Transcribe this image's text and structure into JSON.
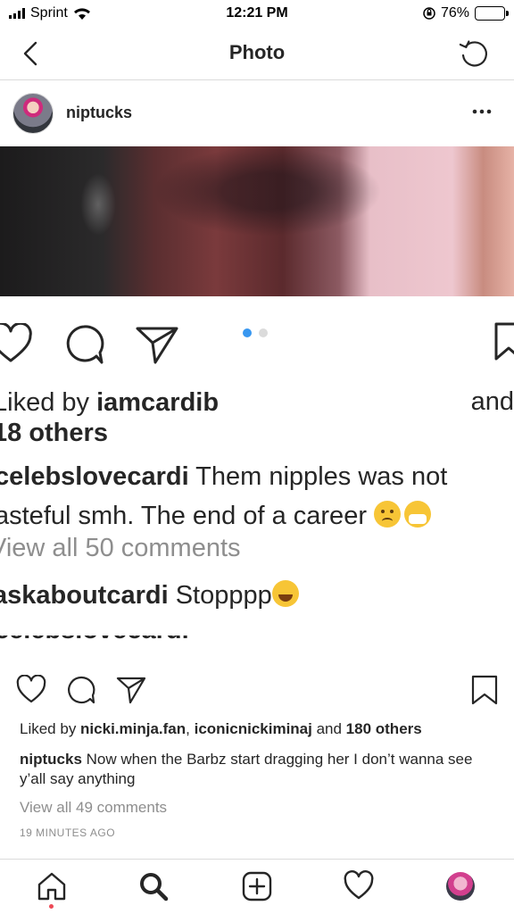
{
  "status_bar": {
    "carrier": "Sprint",
    "time": "12:21 PM",
    "battery": "76%",
    "battery_level": 0.76
  },
  "nav": {
    "title": "Photo"
  },
  "post": {
    "username": "niptucks",
    "photo": {
      "liked_prefix": "Liked by ",
      "liked_user": "iamcardib",
      "liked_and": "and",
      "liked_others": "18 others",
      "caption_user": "celebslovecardi",
      "caption_line1": " Them nipples was not",
      "caption_line2": "asteful smh. The end of a career ",
      "view_all": "View all 50 comments",
      "comment_user": "askaboutcardi",
      "comment_text": " Stopppp",
      "carousel_pages": 2,
      "carousel_active": 1
    },
    "likes_prefix": "Liked by ",
    "liked_by_1": "nicki.minja.fan",
    "likes_sep": ", ",
    "liked_by_2": "iconicnickiminaj",
    "likes_and": " and ",
    "likes_others": "180 others",
    "caption_user": "niptucks",
    "caption_text": " Now when the Barbz start dragging her I don’t wanna see y’all say anything",
    "view_comments": "View all 49 comments",
    "time_ago": "19 MINUTES AGO"
  },
  "icons": {
    "back": "chevron-left-icon",
    "refresh": "refresh-icon",
    "more": "more-icon",
    "like": "heart-icon",
    "comment": "comment-icon",
    "share": "send-icon",
    "save": "bookmark-icon",
    "home": "home-icon",
    "search": "search-icon",
    "new_post": "add-icon",
    "activity": "heart-icon"
  },
  "colors": {
    "link_blue": "#3897f0",
    "muted": "#8e8e8e",
    "text": "#262626",
    "notification": "#ed4956"
  }
}
